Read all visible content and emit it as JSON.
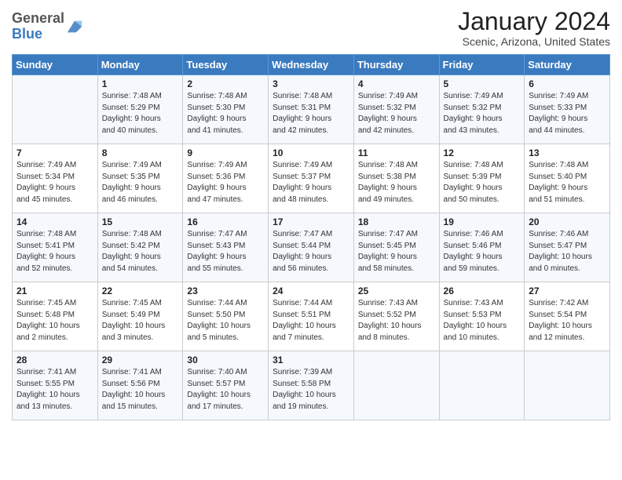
{
  "header": {
    "logo_general": "General",
    "logo_blue": "Blue",
    "month_title": "January 2024",
    "location": "Scenic, Arizona, United States"
  },
  "weekdays": [
    "Sunday",
    "Monday",
    "Tuesday",
    "Wednesday",
    "Thursday",
    "Friday",
    "Saturday"
  ],
  "weeks": [
    [
      {
        "day": "",
        "info": ""
      },
      {
        "day": "1",
        "info": "Sunrise: 7:48 AM\nSunset: 5:29 PM\nDaylight: 9 hours\nand 40 minutes."
      },
      {
        "day": "2",
        "info": "Sunrise: 7:48 AM\nSunset: 5:30 PM\nDaylight: 9 hours\nand 41 minutes."
      },
      {
        "day": "3",
        "info": "Sunrise: 7:48 AM\nSunset: 5:31 PM\nDaylight: 9 hours\nand 42 minutes."
      },
      {
        "day": "4",
        "info": "Sunrise: 7:49 AM\nSunset: 5:32 PM\nDaylight: 9 hours\nand 42 minutes."
      },
      {
        "day": "5",
        "info": "Sunrise: 7:49 AM\nSunset: 5:32 PM\nDaylight: 9 hours\nand 43 minutes."
      },
      {
        "day": "6",
        "info": "Sunrise: 7:49 AM\nSunset: 5:33 PM\nDaylight: 9 hours\nand 44 minutes."
      }
    ],
    [
      {
        "day": "7",
        "info": "Sunrise: 7:49 AM\nSunset: 5:34 PM\nDaylight: 9 hours\nand 45 minutes."
      },
      {
        "day": "8",
        "info": "Sunrise: 7:49 AM\nSunset: 5:35 PM\nDaylight: 9 hours\nand 46 minutes."
      },
      {
        "day": "9",
        "info": "Sunrise: 7:49 AM\nSunset: 5:36 PM\nDaylight: 9 hours\nand 47 minutes."
      },
      {
        "day": "10",
        "info": "Sunrise: 7:49 AM\nSunset: 5:37 PM\nDaylight: 9 hours\nand 48 minutes."
      },
      {
        "day": "11",
        "info": "Sunrise: 7:48 AM\nSunset: 5:38 PM\nDaylight: 9 hours\nand 49 minutes."
      },
      {
        "day": "12",
        "info": "Sunrise: 7:48 AM\nSunset: 5:39 PM\nDaylight: 9 hours\nand 50 minutes."
      },
      {
        "day": "13",
        "info": "Sunrise: 7:48 AM\nSunset: 5:40 PM\nDaylight: 9 hours\nand 51 minutes."
      }
    ],
    [
      {
        "day": "14",
        "info": "Sunrise: 7:48 AM\nSunset: 5:41 PM\nDaylight: 9 hours\nand 52 minutes."
      },
      {
        "day": "15",
        "info": "Sunrise: 7:48 AM\nSunset: 5:42 PM\nDaylight: 9 hours\nand 54 minutes."
      },
      {
        "day": "16",
        "info": "Sunrise: 7:47 AM\nSunset: 5:43 PM\nDaylight: 9 hours\nand 55 minutes."
      },
      {
        "day": "17",
        "info": "Sunrise: 7:47 AM\nSunset: 5:44 PM\nDaylight: 9 hours\nand 56 minutes."
      },
      {
        "day": "18",
        "info": "Sunrise: 7:47 AM\nSunset: 5:45 PM\nDaylight: 9 hours\nand 58 minutes."
      },
      {
        "day": "19",
        "info": "Sunrise: 7:46 AM\nSunset: 5:46 PM\nDaylight: 9 hours\nand 59 minutes."
      },
      {
        "day": "20",
        "info": "Sunrise: 7:46 AM\nSunset: 5:47 PM\nDaylight: 10 hours\nand 0 minutes."
      }
    ],
    [
      {
        "day": "21",
        "info": "Sunrise: 7:45 AM\nSunset: 5:48 PM\nDaylight: 10 hours\nand 2 minutes."
      },
      {
        "day": "22",
        "info": "Sunrise: 7:45 AM\nSunset: 5:49 PM\nDaylight: 10 hours\nand 3 minutes."
      },
      {
        "day": "23",
        "info": "Sunrise: 7:44 AM\nSunset: 5:50 PM\nDaylight: 10 hours\nand 5 minutes."
      },
      {
        "day": "24",
        "info": "Sunrise: 7:44 AM\nSunset: 5:51 PM\nDaylight: 10 hours\nand 7 minutes."
      },
      {
        "day": "25",
        "info": "Sunrise: 7:43 AM\nSunset: 5:52 PM\nDaylight: 10 hours\nand 8 minutes."
      },
      {
        "day": "26",
        "info": "Sunrise: 7:43 AM\nSunset: 5:53 PM\nDaylight: 10 hours\nand 10 minutes."
      },
      {
        "day": "27",
        "info": "Sunrise: 7:42 AM\nSunset: 5:54 PM\nDaylight: 10 hours\nand 12 minutes."
      }
    ],
    [
      {
        "day": "28",
        "info": "Sunrise: 7:41 AM\nSunset: 5:55 PM\nDaylight: 10 hours\nand 13 minutes."
      },
      {
        "day": "29",
        "info": "Sunrise: 7:41 AM\nSunset: 5:56 PM\nDaylight: 10 hours\nand 15 minutes."
      },
      {
        "day": "30",
        "info": "Sunrise: 7:40 AM\nSunset: 5:57 PM\nDaylight: 10 hours\nand 17 minutes."
      },
      {
        "day": "31",
        "info": "Sunrise: 7:39 AM\nSunset: 5:58 PM\nDaylight: 10 hours\nand 19 minutes."
      },
      {
        "day": "",
        "info": ""
      },
      {
        "day": "",
        "info": ""
      },
      {
        "day": "",
        "info": ""
      }
    ]
  ]
}
